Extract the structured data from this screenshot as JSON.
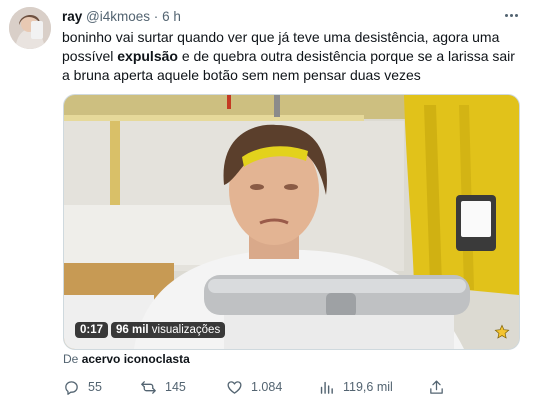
{
  "tweet": {
    "display_name": "ray",
    "handle": "@i4kmoes",
    "dot": "·",
    "time": "6 h",
    "text_part1": "boninho vai surtar quando ver que já teve uma desistência, agora uma possível ",
    "text_bold": "expulsão",
    "text_part2": " e de quebra outra desistência porque se a larissa sair a bruna aperta aquele botão sem nem pensar duas vezes"
  },
  "media": {
    "duration": "0:17",
    "views_count": "96 mil",
    "views_label": " visualizações"
  },
  "source": {
    "prefix": "De ",
    "account": "acervo iconoclasta"
  },
  "actions": {
    "replies": "55",
    "retweets": "145",
    "likes": "1.084",
    "views": "119,6 mil"
  },
  "colors": {
    "text": "#0f1419",
    "secondary": "#536471",
    "border": "#cfd9de"
  }
}
